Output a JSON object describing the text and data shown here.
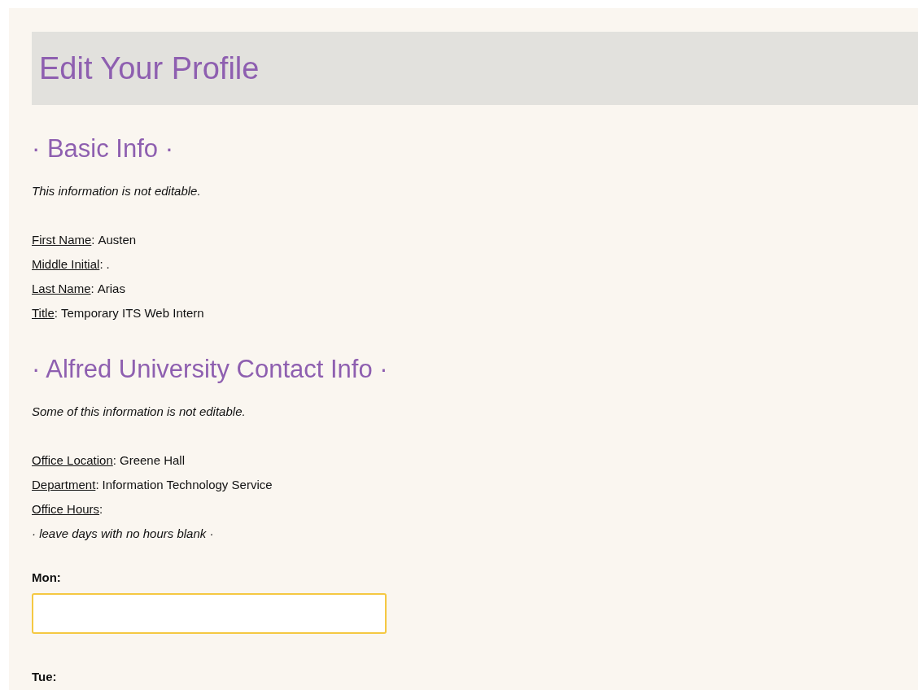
{
  "page_title": "Edit Your Profile",
  "sections": [
    {
      "heading": "· Basic Info ·",
      "note": "This information is not editable.",
      "fields": [
        {
          "label": "First Name",
          "colon": ":",
          "value": "Austen"
        },
        {
          "label": "Middle Initial",
          "colon": ":",
          "value": "."
        },
        {
          "label": "Last Name",
          "colon": ":",
          "value": "Arias"
        },
        {
          "label": "Title",
          "colon": ":",
          "value": "Temporary ITS Web Intern"
        }
      ]
    },
    {
      "heading": "· Alfred University Contact Info ·",
      "note": "Some of this information is not editable.",
      "fields": [
        {
          "label": "Office Location",
          "colon": ":",
          "value": "Greene Hall"
        },
        {
          "label": "Department",
          "colon": ":",
          "value": "Information Technology Service"
        },
        {
          "label": "Office Hours",
          "colon": ":"
        }
      ],
      "hint": "· leave days with no hours blank ·",
      "days": [
        {
          "label": "Mon:",
          "focused": true
        },
        {
          "label": "Tue:"
        }
      ]
    }
  ]
}
